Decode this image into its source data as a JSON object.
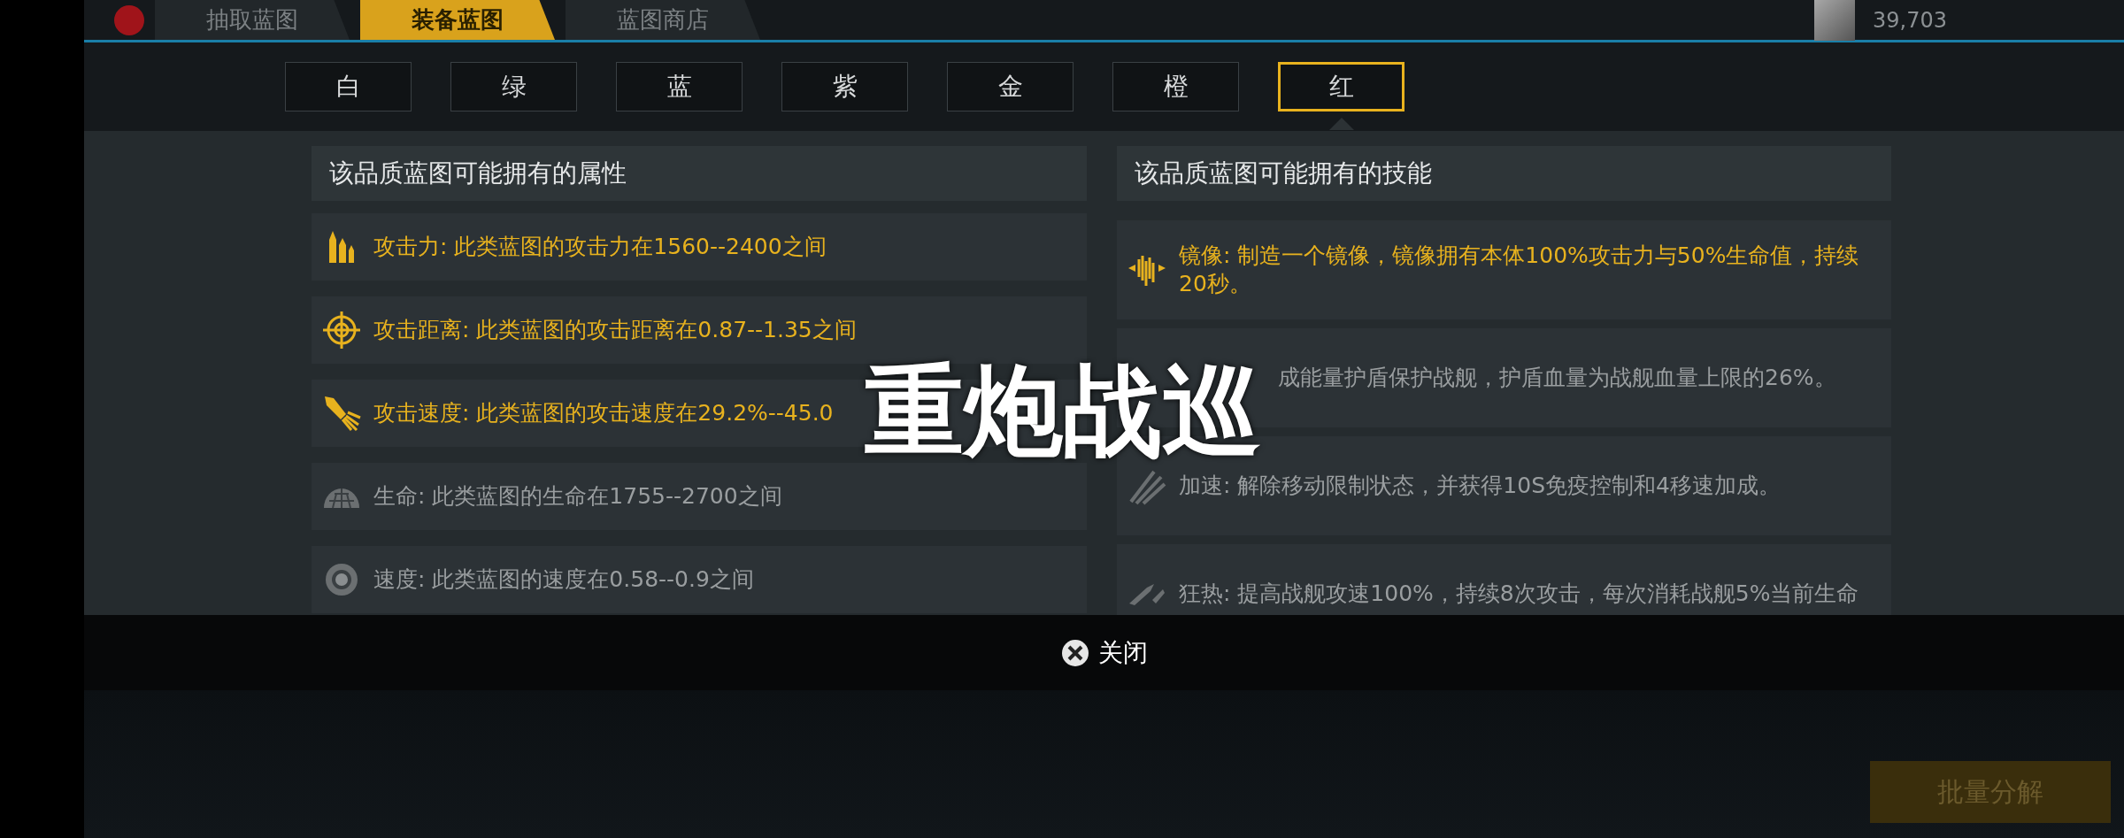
{
  "top_tabs": [
    {
      "label": "抽取蓝图",
      "selected": false
    },
    {
      "label": "装备蓝图",
      "selected": true
    },
    {
      "label": "蓝图商店",
      "selected": false
    }
  ],
  "energy": {
    "value": "39,703"
  },
  "qualities": [
    {
      "label": "白",
      "selected": false
    },
    {
      "label": "绿",
      "selected": false
    },
    {
      "label": "蓝",
      "selected": false
    },
    {
      "label": "紫",
      "selected": false
    },
    {
      "label": "金",
      "selected": false
    },
    {
      "label": "橙",
      "selected": false
    },
    {
      "label": "红",
      "selected": true
    }
  ],
  "attributes": {
    "title": "该品质蓝图可能拥有的属性",
    "items": [
      {
        "text": "攻击力: 此类蓝图的攻击力在1560--2400之间",
        "highlighted": true
      },
      {
        "text": "攻击距离: 此类蓝图的攻击距离在0.87--1.35之间",
        "highlighted": true
      },
      {
        "text": "攻击速度: 此类蓝图的攻击速度在29.2%--45.0",
        "highlighted": true
      },
      {
        "text": "生命: 此类蓝图的生命在1755--2700之间",
        "highlighted": false
      },
      {
        "text": "速度: 此类蓝图的速度在0.58--0.9之间",
        "highlighted": false
      }
    ]
  },
  "skills": {
    "title": "该品质蓝图可能拥有的技能",
    "items": [
      {
        "text": "镜像: 制造一个镜像，镜像拥有本体100%攻击力与50%生命值，持续20秒。",
        "highlighted": true
      },
      {
        "text": "成能量护盾保护战舰，护盾血量为战舰血量上限的26%。",
        "highlighted": false
      },
      {
        "text": "加速: 解除移动限制状态，并获得10S免疫控制和4移速加成。",
        "highlighted": false
      },
      {
        "text": "狂热: 提高战舰攻速100%，持续8次攻击，每次消耗战舰5%当前生命",
        "highlighted": false
      }
    ]
  },
  "close_button": "关闭",
  "bulk_button": "批量分解",
  "caption": "重炮战巡"
}
